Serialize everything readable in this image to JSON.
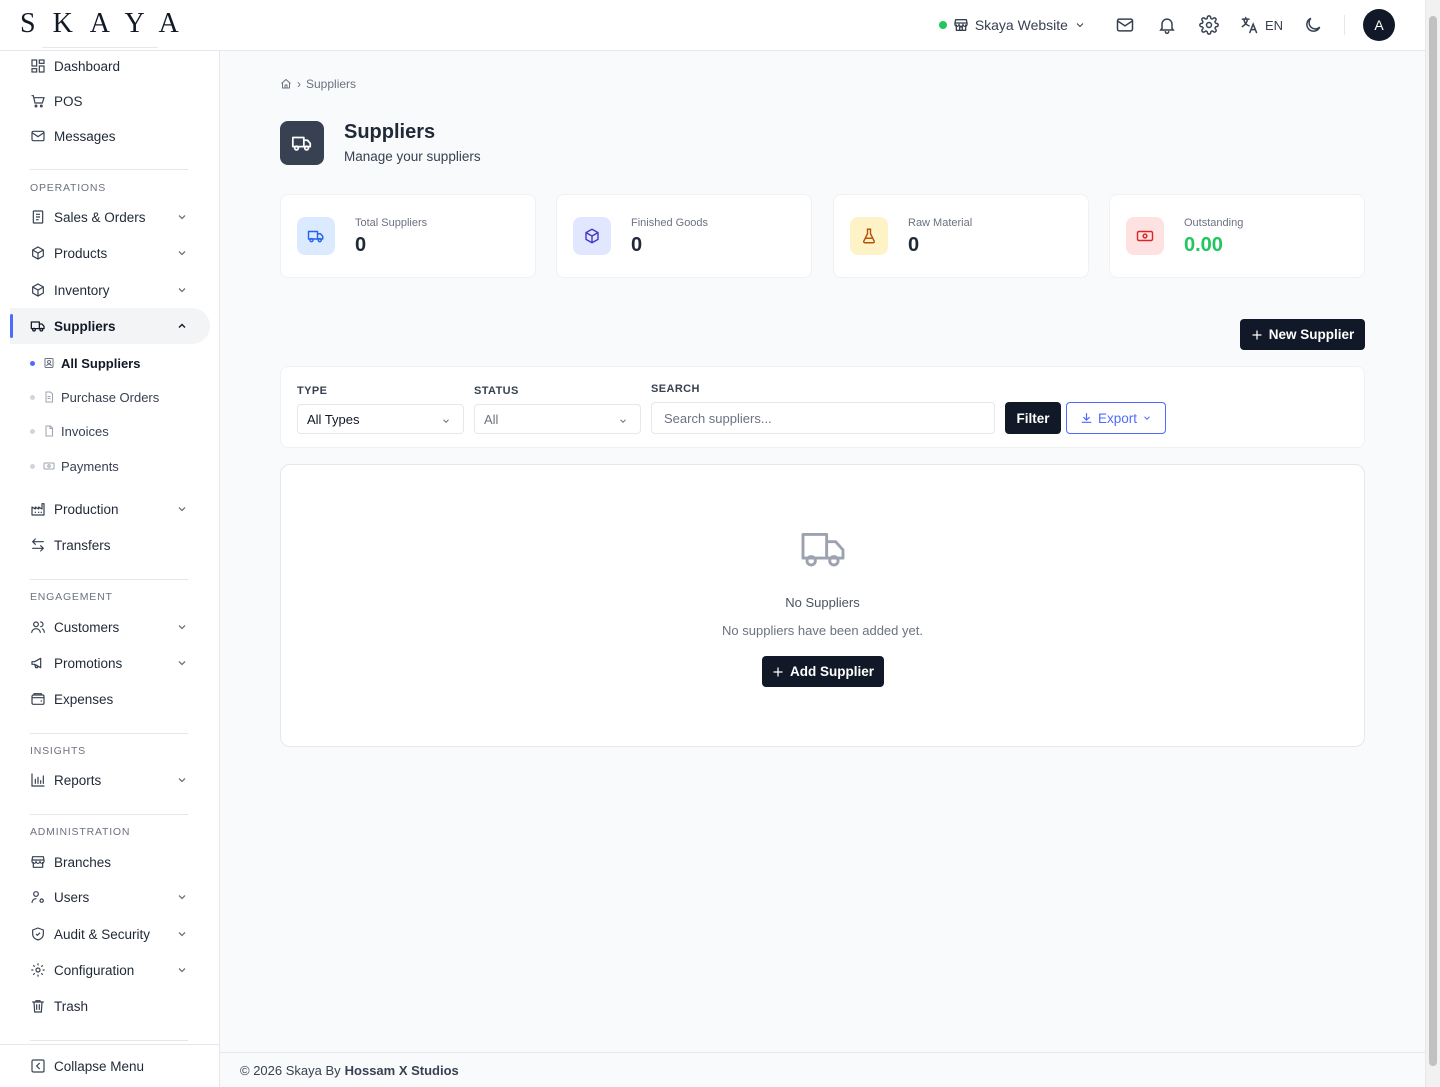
{
  "header": {
    "logo": "SKAYA",
    "site_name": "Skaya Website",
    "language": "EN",
    "avatar_initial": "A",
    "icons": [
      "store-icon",
      "mail-icon",
      "bell-icon",
      "gear-icon",
      "translate-icon",
      "moon-icon"
    ]
  },
  "sidebar": {
    "top_items": [
      {
        "label": "Dashboard",
        "icon": "dashboard-icon"
      },
      {
        "label": "POS",
        "icon": "cart-icon"
      },
      {
        "label": "Messages",
        "icon": "mail-icon"
      }
    ],
    "sections": {
      "operations": "OPERATIONS",
      "engagement": "ENGAGEMENT",
      "insights": "INSIGHTS",
      "administration": "ADMINISTRATION"
    },
    "operations_items": [
      {
        "label": "Sales & Orders"
      },
      {
        "label": "Products"
      },
      {
        "label": "Inventory"
      },
      {
        "label": "Suppliers"
      }
    ],
    "supplier_sub_items": [
      {
        "label": "All Suppliers"
      },
      {
        "label": "Purchase Orders"
      },
      {
        "label": "Invoices"
      },
      {
        "label": "Payments"
      }
    ],
    "operations_items_2": [
      {
        "label": "Production"
      },
      {
        "label": "Transfers"
      }
    ],
    "engagement_items": [
      {
        "label": "Customers"
      },
      {
        "label": "Promotions"
      },
      {
        "label": "Expenses"
      }
    ],
    "insights_items": [
      {
        "label": "Reports"
      }
    ],
    "administration_items": [
      {
        "label": "Branches"
      },
      {
        "label": "Users"
      },
      {
        "label": "Audit & Security"
      },
      {
        "label": "Configuration"
      },
      {
        "label": "Trash"
      }
    ],
    "collapse_label": "Collapse Menu"
  },
  "breadcrumb": {
    "current": "Suppliers"
  },
  "page": {
    "title": "Suppliers",
    "subtitle": "Manage your suppliers"
  },
  "stats": [
    {
      "label": "Total Suppliers",
      "value": "0",
      "icon": "truck-icon",
      "bg": "#dbeafe",
      "fg": "#2563eb"
    },
    {
      "label": "Finished Goods",
      "value": "0",
      "icon": "box-icon",
      "bg": "#e0e7ff",
      "fg": "#4338ca"
    },
    {
      "label": "Raw Material",
      "value": "0",
      "icon": "flask-icon",
      "bg": "#fef3c7",
      "fg": "#b45309"
    },
    {
      "label": "Outstanding",
      "value": "0.00",
      "icon": "cash-icon",
      "bg": "#fee2e2",
      "fg": "#dc2626",
      "value_color": "#22c55e"
    }
  ],
  "actions": {
    "new_supplier": "New Supplier"
  },
  "filters": {
    "type_label": "TYPE",
    "type_value": "All Types",
    "status_label": "STATUS",
    "status_value": "All",
    "search_label": "SEARCH",
    "search_placeholder": "Search suppliers...",
    "filter_button": "Filter",
    "export_button": "Export"
  },
  "empty": {
    "title": "No Suppliers",
    "subtitle": "No suppliers have been added yet.",
    "button": "Add Supplier"
  },
  "footer": {
    "copyright": "© 2026 Skaya By",
    "company": "Hossam X Studios"
  },
  "colors": {
    "accent": "#4f6bff",
    "dark": "#111827",
    "success": "#22c55e"
  }
}
